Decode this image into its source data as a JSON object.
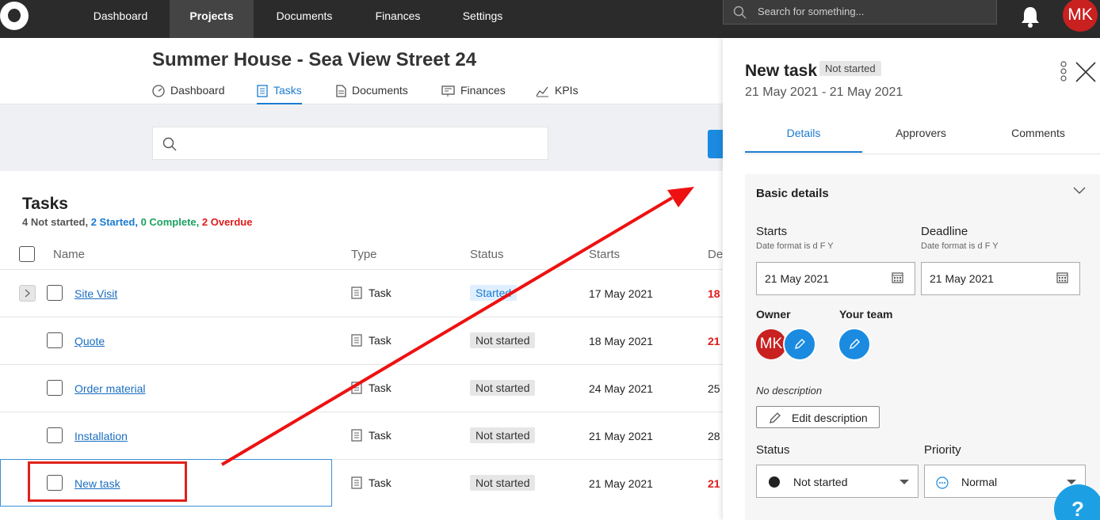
{
  "topnav": {
    "items": [
      {
        "label": "Dashboard"
      },
      {
        "label": "Projects"
      },
      {
        "label": "Documents"
      },
      {
        "label": "Finances"
      },
      {
        "label": "Settings"
      }
    ],
    "active": "Projects",
    "search_placeholder": "Search for something...",
    "user_initials": "MK"
  },
  "project": {
    "title": "Summer House - Sea View Street 24",
    "tabs": [
      {
        "label": "Dashboard",
        "icon": "dashboard-icon"
      },
      {
        "label": "Tasks",
        "icon": "tasks-icon"
      },
      {
        "label": "Documents",
        "icon": "documents-icon"
      },
      {
        "label": "Finances",
        "icon": "finances-icon"
      },
      {
        "label": "KPIs",
        "icon": "kpis-icon"
      }
    ],
    "active_tab": "Tasks"
  },
  "tasks": {
    "heading": "Tasks",
    "summary": {
      "not_started": "4 Not started,",
      "started": "2 Started,",
      "complete": "0 Complete,",
      "overdue": "2 Overdue"
    },
    "columns": {
      "name": "Name",
      "type": "Type",
      "status": "Status",
      "starts": "Starts",
      "deadline": "De"
    },
    "rows": [
      {
        "name": "Site Visit",
        "type": "Task",
        "status": "Started",
        "starts": "17 May 2021",
        "deadline": "18"
      },
      {
        "name": "Quote",
        "type": "Task",
        "status": "Not started",
        "starts": "18 May 2021",
        "deadline": "21"
      },
      {
        "name": "Order material",
        "type": "Task",
        "status": "Not started",
        "starts": "24 May 2021",
        "deadline": "25"
      },
      {
        "name": "Installation",
        "type": "Task",
        "status": "Not started",
        "starts": "21 May 2021",
        "deadline": "28"
      },
      {
        "name": "New task",
        "type": "Task",
        "status": "Not started",
        "starts": "21 May 2021",
        "deadline": "21"
      }
    ]
  },
  "panel": {
    "title": "New task",
    "status_badge": "Not started",
    "date_range": "21 May 2021 - 21 May 2021",
    "tabs": [
      {
        "label": "Details"
      },
      {
        "label": "Approvers"
      },
      {
        "label": "Comments"
      }
    ],
    "active_tab": "Details",
    "section_title": "Basic details",
    "starts_label": "Starts",
    "starts_hint": "Date format is d F Y",
    "starts_value": "21 May 2021",
    "deadline_label": "Deadline",
    "deadline_hint": "Date format is d F Y",
    "deadline_value": "21 May 2021",
    "owner_label": "Owner",
    "owner_initials": "MK",
    "team_label": "Your team",
    "no_description": "No description",
    "edit_description": "Edit description",
    "status_label": "Status",
    "status_value": "Not started",
    "priority_label": "Priority",
    "priority_value": "Normal"
  },
  "help_label": "?",
  "colors": {
    "nav_bg": "#2b2b2b",
    "accent_blue": "#1a7bd0",
    "overdue_red": "#e01b1b",
    "complete_green": "#1aa15f",
    "avatar_red": "#c92020",
    "annotation_red": "#e0221b"
  }
}
